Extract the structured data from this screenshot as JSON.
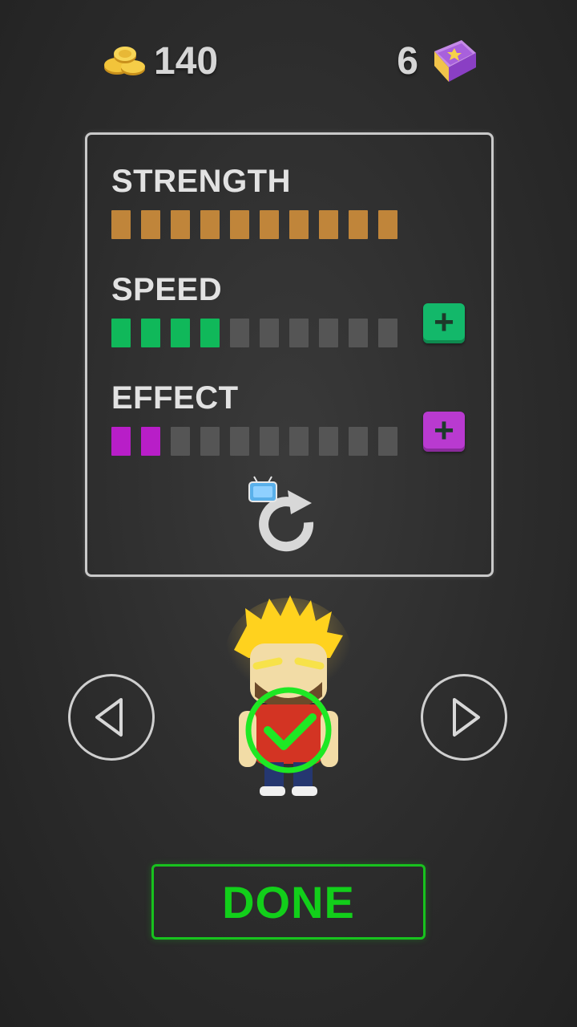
{
  "hud": {
    "coins": "140",
    "coins_icon": "gold-coins-icon",
    "books": "6",
    "books_icon": "purple-book-icon"
  },
  "stats": [
    {
      "label": "STRENGTH",
      "level": 10,
      "max": 10,
      "color": "#c0853a",
      "upgrade": false
    },
    {
      "label": "SPEED",
      "level": 4,
      "max": 10,
      "color": "#10b85a",
      "upgrade": true,
      "upgrade_color": "#13b86a"
    },
    {
      "label": "EFFECT",
      "level": 2,
      "max": 10,
      "color": "#b81ec8",
      "upgrade": true,
      "upgrade_color": "#b93ad0"
    }
  ],
  "reroll_icon": "reroll-ad-icon",
  "character": {
    "selected": true,
    "icon": "checkmark-icon"
  },
  "nav": {
    "prev_icon": "triangle-left-icon",
    "next_icon": "triangle-right-icon"
  },
  "done_label": "DONE",
  "colors": {
    "accent": "#12cf1a",
    "empty_segment": "#555555"
  }
}
